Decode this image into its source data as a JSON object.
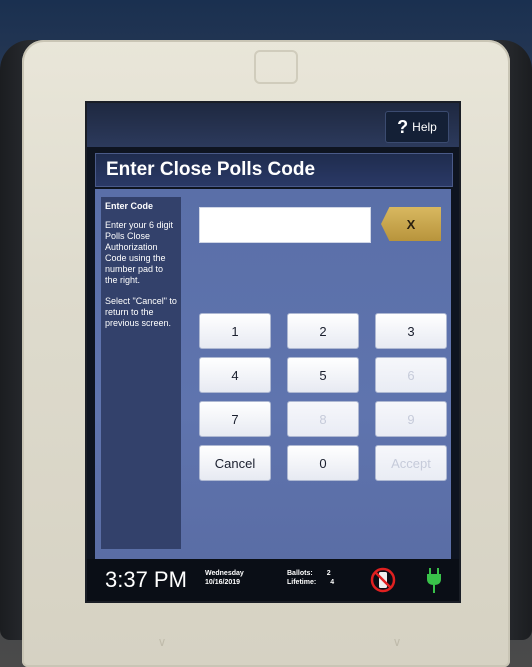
{
  "topbar": {
    "help_label": "Help",
    "help_icon": "question-mark-icon"
  },
  "title": "Enter Close Polls Code",
  "side_panel": {
    "heading": "Enter Code",
    "instruction": "Enter your 6 digit Polls Close Authorization Code using the number pad to the right.",
    "cancel_hint": "Select \"Cancel\" to return to the previous screen."
  },
  "code_input": {
    "value": ""
  },
  "clear_button": {
    "label": "X"
  },
  "keypad": {
    "k1": "1",
    "k2": "2",
    "k3": "3",
    "k4": "4",
    "k5": "5",
    "k6": "6",
    "k7": "7",
    "k8": "8",
    "k9": "9",
    "cancel": "Cancel",
    "k0": "0",
    "accept": "Accept"
  },
  "status": {
    "time": "3:37 PM",
    "weekday": "Wednesday",
    "date": "10/16/2019",
    "ballots_label": "Ballots:",
    "ballots_value": "2",
    "lifetime_label": "Lifetime:",
    "lifetime_value": "4"
  },
  "colors": {
    "accent_gold": "#c9a74c",
    "panel_blue": "#5f74ae",
    "power_green": "#39c24a",
    "warning_red": "#e02020"
  }
}
